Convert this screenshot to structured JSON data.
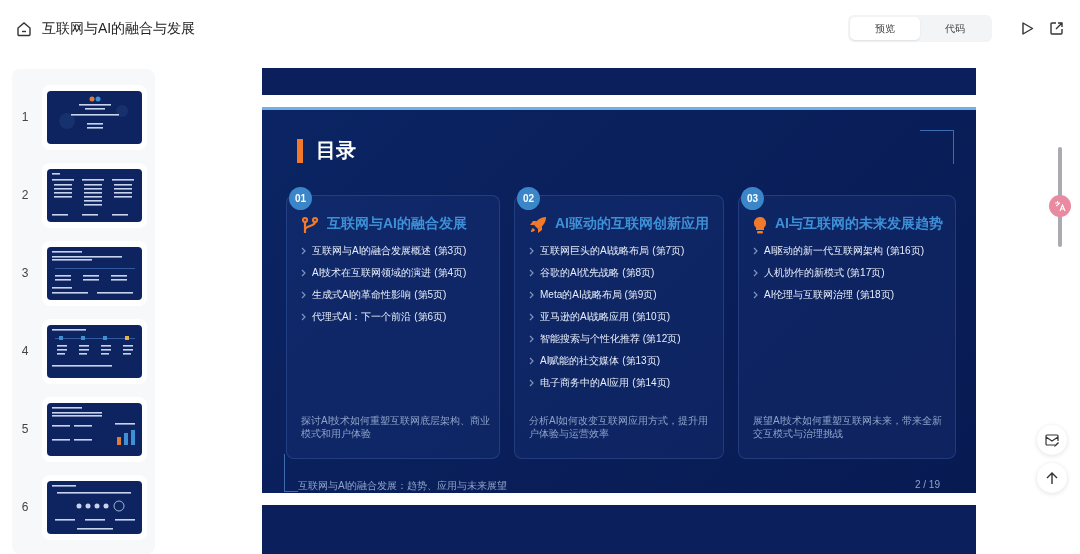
{
  "header": {
    "title": "互联网与AI的融合与发展",
    "view_tabs": [
      {
        "label": "预览",
        "selected": true
      },
      {
        "label": "代码",
        "selected": false
      }
    ]
  },
  "thumbnails": [
    {
      "number": "1"
    },
    {
      "number": "2"
    },
    {
      "number": "3"
    },
    {
      "number": "4"
    },
    {
      "number": "5"
    },
    {
      "number": "6"
    }
  ],
  "slide": {
    "heading": "目录",
    "cards": [
      {
        "badge": "01",
        "kind": "branch",
        "title": "互联网与AI的融合发展",
        "items": [
          "互联网与AI的融合发展概述 (第3页)",
          "AI技术在互联网领域的演进 (第4页)",
          "生成式AI的革命性影响 (第5页)",
          "代理式AI：下一个前沿 (第6页)"
        ],
        "summary": "探讨AI技术如何重塑互联网底层架构、商业模式和用户体验"
      },
      {
        "badge": "02",
        "kind": "rocket",
        "title": "AI驱动的互联网创新应用",
        "items": [
          "互联网巨头的AI战略布局 (第7页)",
          "谷歌的AI优先战略 (第8页)",
          "Meta的AI战略布局 (第9页)",
          "亚马逊的AI战略应用 (第10页)",
          "智能搜索与个性化推荐 (第12页)",
          "AI赋能的社交媒体 (第13页)",
          "电子商务中的AI应用 (第14页)"
        ],
        "summary": "分析AI如何改变互联网应用方式，提升用户体验与运营效率"
      },
      {
        "badge": "03",
        "kind": "bulb",
        "title": "AI与互联网的未来发展趋势",
        "items": [
          "AI驱动的新一代互联网架构 (第16页)",
          "人机协作的新模式 (第17页)",
          "AI伦理与互联网治理 (第18页)"
        ],
        "summary": "展望AI技术如何重塑互联网未来，带来全新交互模式与治理挑战"
      }
    ],
    "footer": "互联网与AI的融合发展：趋势、应用与未来展望",
    "page": "2 / 19"
  }
}
